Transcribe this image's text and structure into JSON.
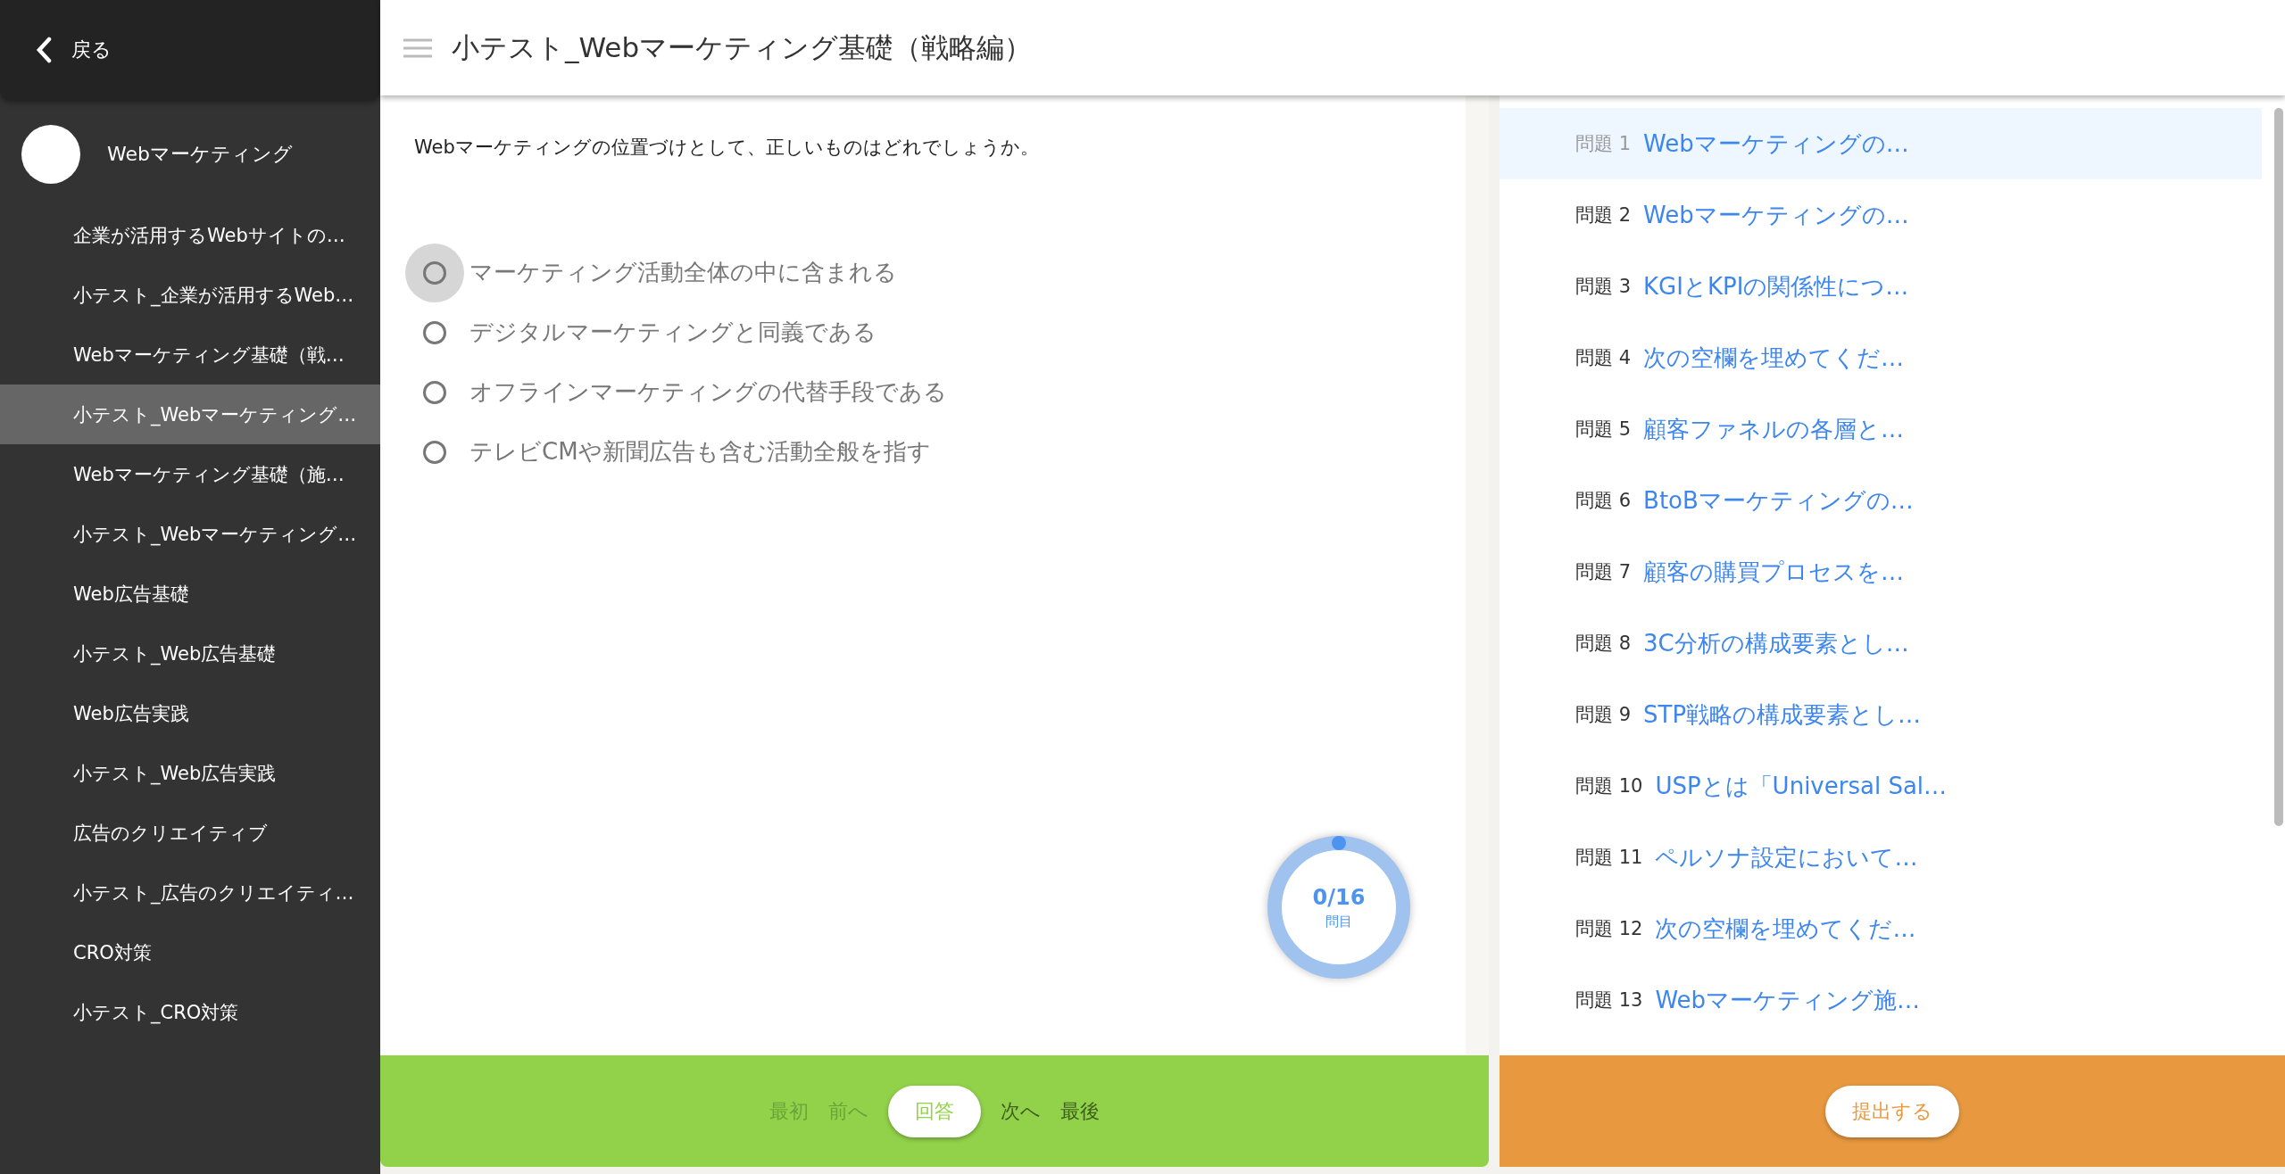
{
  "sidebar": {
    "back": "戻る",
    "course": {
      "title": "Webマーケティング"
    },
    "items": [
      {
        "label": "企業が活用するWebサイトの…",
        "selected": false
      },
      {
        "label": "小テスト_企業が活用するWeb…",
        "selected": false
      },
      {
        "label": "Webマーケティング基礎（戦…",
        "selected": false
      },
      {
        "label": "小テスト_Webマーケティング…",
        "selected": true
      },
      {
        "label": "Webマーケティング基礎（施…",
        "selected": false
      },
      {
        "label": "小テスト_Webマーケティング…",
        "selected": false
      },
      {
        "label": "Web広告基礎",
        "selected": false
      },
      {
        "label": "小テスト_Web広告基礎",
        "selected": false
      },
      {
        "label": "Web広告実践",
        "selected": false
      },
      {
        "label": "小テスト_Web広告実践",
        "selected": false
      },
      {
        "label": "広告のクリエイティブ",
        "selected": false
      },
      {
        "label": "小テスト_広告のクリエイティ…",
        "selected": false
      },
      {
        "label": "CRO対策",
        "selected": false
      },
      {
        "label": "小テスト_CRO対策",
        "selected": false
      }
    ]
  },
  "header": {
    "title": "小テスト_Webマーケティング基礎（戦略編）"
  },
  "question": {
    "text": "Webマーケティングの位置づけとして、正しいものはどれでしょうか。",
    "options": [
      {
        "label": "マーケティング活動全体の中に含まれる",
        "selected": false,
        "focused": true
      },
      {
        "label": "デジタルマーケティングと同義である",
        "selected": false,
        "focused": false
      },
      {
        "label": "オフラインマーケティングの代替手段である",
        "selected": false,
        "focused": false
      },
      {
        "label": "テレビCMや新聞広告も含む活動全般を指す",
        "selected": false,
        "focused": false
      }
    ]
  },
  "progress": {
    "count": "0/16",
    "unit": "問目"
  },
  "navigation": [
    {
      "label": "最初",
      "kind": "link",
      "disabled": true
    },
    {
      "label": "前へ",
      "kind": "link",
      "disabled": true
    },
    {
      "label": "回答",
      "kind": "primary",
      "disabled": false
    },
    {
      "label": "次へ",
      "kind": "link",
      "disabled": false
    },
    {
      "label": "最後",
      "kind": "link",
      "disabled": false
    }
  ],
  "question_list": {
    "items": [
      {
        "number": "問題 1",
        "title": "Webマーケティングの…",
        "selected": true
      },
      {
        "number": "問題 2",
        "title": "Webマーケティングの…",
        "selected": false
      },
      {
        "number": "問題 3",
        "title": "KGIとKPIの関係性につ…",
        "selected": false
      },
      {
        "number": "問題 4",
        "title": "次の空欄を埋めてくだ…",
        "selected": false
      },
      {
        "number": "問題 5",
        "title": "顧客ファネルの各層と…",
        "selected": false
      },
      {
        "number": "問題 6",
        "title": "BtoBマーケティングの…",
        "selected": false
      },
      {
        "number": "問題 7",
        "title": "顧客の購買プロセスを…",
        "selected": false
      },
      {
        "number": "問題 8",
        "title": "3C分析の構成要素とし…",
        "selected": false
      },
      {
        "number": "問題 9",
        "title": "STP戦略の構成要素とし…",
        "selected": false
      },
      {
        "number": "問題 10",
        "title": "USPとは「Universal Sal…",
        "selected": false
      },
      {
        "number": "問題 11",
        "title": "ペルソナ設定において…",
        "selected": false
      },
      {
        "number": "問題 12",
        "title": "次の空欄を埋めてくだ…",
        "selected": false
      },
      {
        "number": "問題 13",
        "title": "Webマーケティング施…",
        "selected": false
      }
    ]
  },
  "submit": {
    "label": "提出する"
  }
}
